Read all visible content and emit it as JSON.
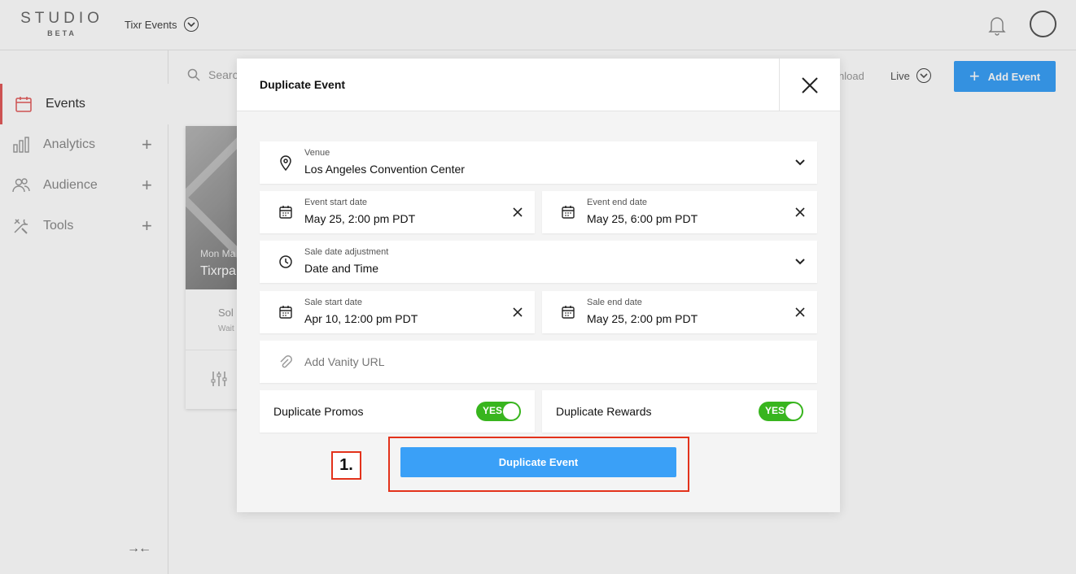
{
  "app": {
    "logo_main": "STUDIO",
    "logo_sub": "BETA",
    "org_name": "Tixr Events"
  },
  "sidebar": {
    "items": [
      {
        "label": "Events",
        "icon": "calendar-icon",
        "active": true
      },
      {
        "label": "Analytics",
        "icon": "bar-chart-icon",
        "expandable": true
      },
      {
        "label": "Audience",
        "icon": "people-icon",
        "expandable": true
      },
      {
        "label": "Tools",
        "icon": "tools-icon",
        "expandable": true
      }
    ],
    "collapse_glyph": "→←"
  },
  "toolbar": {
    "search_placeholder": "Searc",
    "download_label": "nload",
    "live_filter": "Live",
    "add_event_label": "Add Event"
  },
  "event_card": {
    "date": "Mon Ma",
    "title": "Tixrpa",
    "status": "Sol",
    "sub_status": "Wait"
  },
  "modal": {
    "title": "Duplicate Event",
    "venue": {
      "label": "Venue",
      "value": "Los Angeles Convention Center"
    },
    "event_start": {
      "label": "Event start date",
      "value": "May 25, 2:00 pm PDT"
    },
    "event_end": {
      "label": "Event end date",
      "value": "May 25, 6:00 pm PDT"
    },
    "sale_adjustment": {
      "label": "Sale date adjustment",
      "value": "Date and Time"
    },
    "sale_start": {
      "label": "Sale start date",
      "value": "Apr 10, 12:00 pm PDT"
    },
    "sale_end": {
      "label": "Sale end date",
      "value": "May 25, 2:00 pm PDT"
    },
    "vanity_url": {
      "placeholder": "Add Vanity URL"
    },
    "duplicate_promos": {
      "label": "Duplicate Promos",
      "toggle_text": "YES",
      "on": true
    },
    "duplicate_rewards": {
      "label": "Duplicate Rewards",
      "toggle_text": "YES",
      "on": true
    },
    "submit_label": "Duplicate Event"
  },
  "annotation": {
    "step_label": "1.",
    "color": "#e3321b"
  },
  "colors": {
    "primary": "#3aa0f7",
    "toggle_on": "#38b51e",
    "active_accent": "#e25b5b"
  }
}
